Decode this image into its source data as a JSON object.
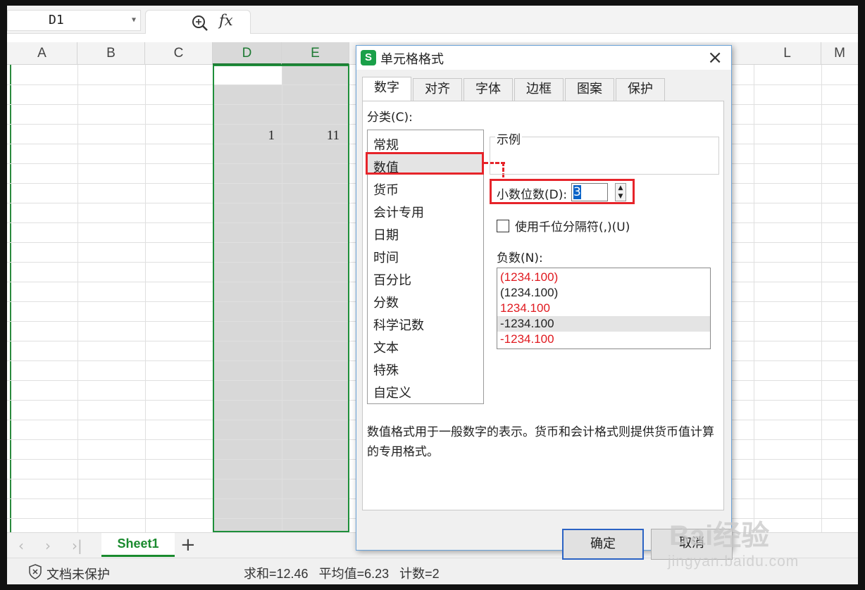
{
  "formula_bar": {
    "name_box": "D1",
    "zoom_icon": "zoom-search-icon",
    "fx_label": "fx"
  },
  "columns": [
    "A",
    "B",
    "C",
    "D",
    "E",
    "L",
    "M"
  ],
  "cells": {
    "D4": "1",
    "E4": "11"
  },
  "sheet_tabs": {
    "active": "Sheet1",
    "add": "+"
  },
  "status_bar": {
    "protection": "文档未保护",
    "sum": "求和=12.46",
    "average": "平均值=6.23",
    "count": "计数=2"
  },
  "dialog": {
    "logo": "S",
    "title": "单元格格式",
    "tabs": [
      "数字",
      "对齐",
      "字体",
      "边框",
      "图案",
      "保护"
    ],
    "active_tab": "数字",
    "category_label": "分类(C):",
    "categories": [
      "常规",
      "数值",
      "货币",
      "会计专用",
      "日期",
      "时间",
      "百分比",
      "分数",
      "科学记数",
      "文本",
      "特殊",
      "自定义"
    ],
    "selected_category": "数值",
    "sample_label": "示例",
    "decimal_label": "小数位数(D):",
    "decimal_value": "3",
    "thousands_label": "使用千位分隔符(,)(U)",
    "negative_label": "负数(N):",
    "negative_options": [
      {
        "text": "(1234.100)",
        "color": "#e0191f"
      },
      {
        "text": "(1234.100)",
        "color": "#222222"
      },
      {
        "text": "1234.100",
        "color": "#e0191f"
      },
      {
        "text": "-1234.100",
        "color": "#222222"
      },
      {
        "text": "-1234.100",
        "color": "#e0191f"
      }
    ],
    "selected_negative": 3,
    "description": "数值格式用于一般数字的表示。货币和会计格式则提供货币值计算的专用格式。",
    "ok_label": "确定",
    "cancel_label": "取消",
    "highlight_color": "#e6242a"
  },
  "watermark": {
    "brand": "Bai经验",
    "url": "jingyan.baidu.com"
  }
}
